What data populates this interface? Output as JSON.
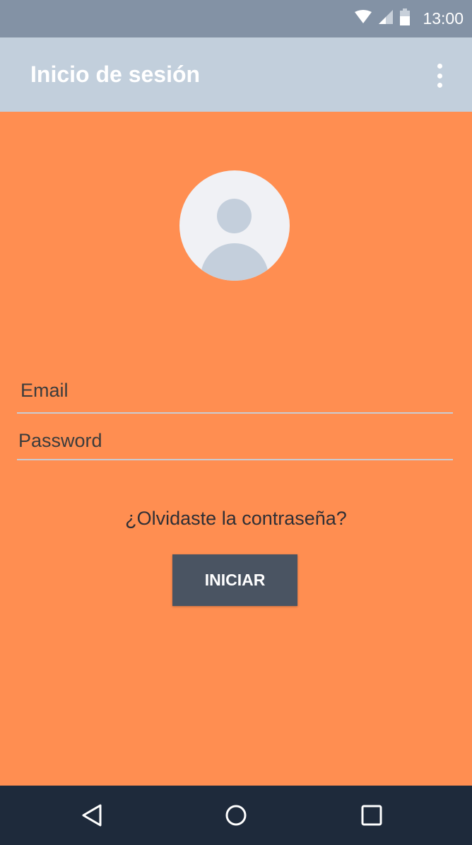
{
  "status_bar": {
    "time": "13:00",
    "icons": [
      "wifi-icon",
      "cell-signal-icon",
      "battery-icon"
    ]
  },
  "app_bar": {
    "title": "Inicio de sesión",
    "menu_icon": "more-vert-icon"
  },
  "avatar": {
    "icon": "person-placeholder-icon"
  },
  "form": {
    "email_placeholder": "Email",
    "password_placeholder": "Password",
    "forgot_password": "¿Olvidaste la contraseña?",
    "login_button": "INICIAR"
  },
  "nav_bar": {
    "icons": [
      "back-icon",
      "home-icon",
      "recents-icon"
    ]
  },
  "colors": {
    "status_bar": "#8392a5",
    "app_bar": "#c2cfdc",
    "background": "#ff8e51",
    "button": "#4a5462",
    "nav_bar": "#1e2a3b"
  }
}
